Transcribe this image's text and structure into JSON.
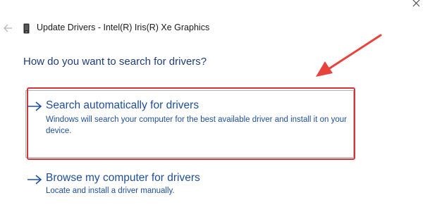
{
  "window": {
    "title": "Update Drivers - Intel(R) Iris(R) Xe Graphics",
    "close_icon": "close-icon",
    "back_icon": "back-arrow-icon",
    "device_icon": "device-icon"
  },
  "main": {
    "heading": "How do you want to search for drivers?",
    "options": [
      {
        "title": "Search automatically for drivers",
        "description": "Windows will search your computer for the best available driver and install it on your device.",
        "icon": "arrow-right-icon",
        "highlighted": true
      },
      {
        "title": "Browse my computer for drivers",
        "description": "Locate and install a driver manually.",
        "icon": "arrow-right-icon",
        "highlighted": false
      }
    ]
  },
  "colors": {
    "link": "#1f4e99",
    "heading": "#1e3d7a",
    "highlight": "#d9333a",
    "annotation_arrow": "#e8423c"
  }
}
